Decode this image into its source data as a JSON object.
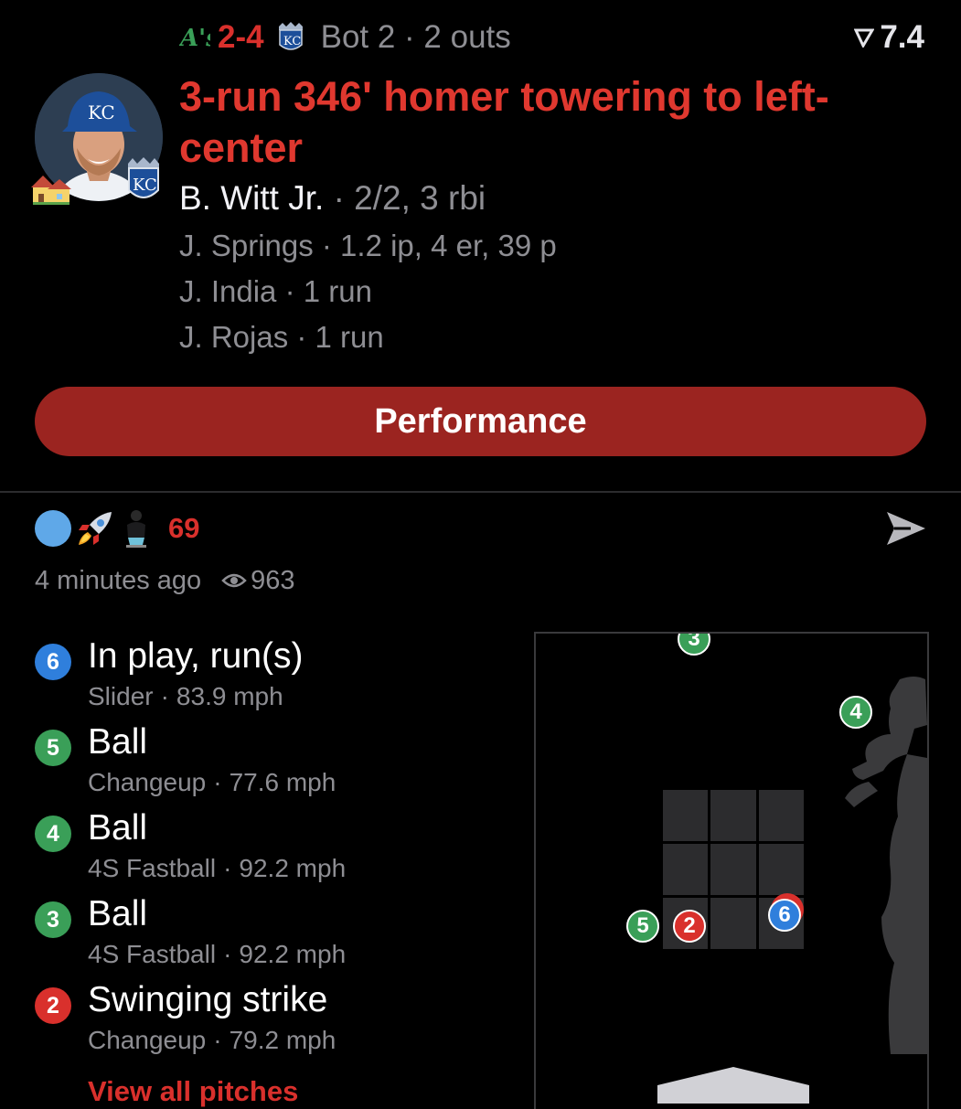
{
  "header": {
    "away_team_icon": "athletics-logo-icon",
    "score": "2-4",
    "home_team_icon": "royals-logo-icon",
    "inning_status": "Bot 2 · 2 outs",
    "rating": "7.4"
  },
  "play": {
    "headline": "3-run 346' homer towering to left-center",
    "batter_name": "B. Witt Jr.",
    "batter_stats": "· 2/2, 3 rbi",
    "lines": [
      "J. Springs · 1.2 ip, 4 er, 39 p",
      "J. India · 1 run",
      "J. Rojas · 1 run"
    ],
    "performance_label": "Performance"
  },
  "reactions": {
    "count": "69",
    "time_ago": "4 minutes ago",
    "views": "963"
  },
  "pitches": [
    {
      "num": "6",
      "result": "In play, run(s)",
      "type": "Slider",
      "speed": "83.9 mph",
      "color": "#2f7fdc"
    },
    {
      "num": "5",
      "result": "Ball",
      "type": "Changeup",
      "speed": "77.6 mph",
      "color": "#3a9f58"
    },
    {
      "num": "4",
      "result": "Ball",
      "type": "4S Fastball",
      "speed": "92.2 mph",
      "color": "#3a9f58"
    },
    {
      "num": "3",
      "result": "Ball",
      "type": "4S Fastball",
      "speed": "92.2 mph",
      "color": "#3a9f58"
    },
    {
      "num": "2",
      "result": "Swinging strike",
      "type": "Changeup",
      "speed": "79.2 mph",
      "color": "#d9302c"
    }
  ],
  "view_all_label": "View all pitches",
  "zone_marks": [
    {
      "num": "3",
      "color": "#3a9f58"
    },
    {
      "num": "4",
      "color": "#3a9f58"
    },
    {
      "num": "5",
      "color": "#3a9f58"
    },
    {
      "num": "2",
      "color": "#d9302c"
    },
    {
      "num": "6",
      "color": "#2f7fdc"
    }
  ],
  "colors": {
    "accent_red": "#d9302c",
    "button_red": "#9b2420",
    "ball_green": "#3a9f58",
    "in_play_blue": "#2f7fdc",
    "muted_gray": "#8e8e93"
  }
}
